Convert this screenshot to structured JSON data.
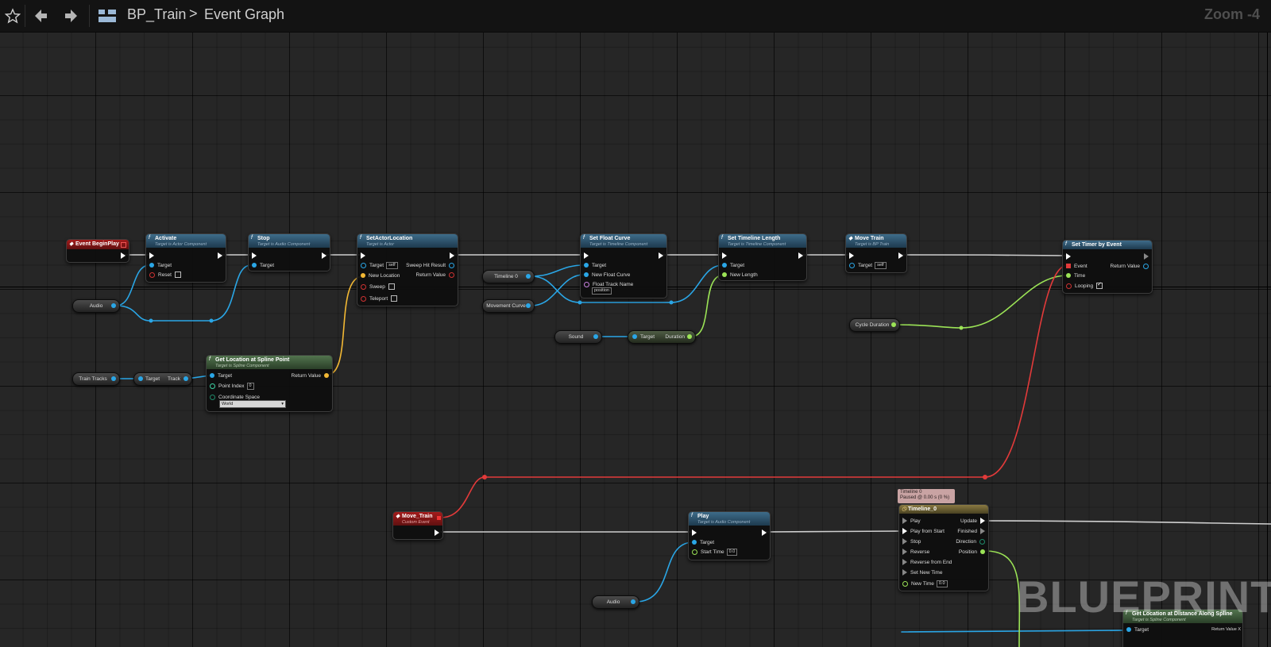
{
  "toolbar": {
    "favorite_icon": "star-icon",
    "back_icon": "arrow-left-icon",
    "forward_icon": "arrow-right-icon",
    "blueprint_icon": "blueprint-graph-icon",
    "breadcrumb_asset": "BP_Train",
    "breadcrumb_separator": ">",
    "breadcrumb_graph": "Event Graph",
    "zoom": "Zoom -4"
  },
  "colors": {
    "exec_wire": "#cfcfcf",
    "object_wire": "#2aa6e6",
    "vector_wire": "#f2b834",
    "float_wire": "#9be356",
    "delegate_wire": "#e23a3a",
    "function_header": "#2c5573",
    "event_header": "#8b1a1a"
  },
  "nodes": {
    "event_begin_play": {
      "title": "Event BeginPlay"
    },
    "activate": {
      "title": "Activate",
      "subtitle": "Target is Actor Component",
      "pin_target": "Target",
      "pin_reset": "Reset"
    },
    "stop": {
      "title": "Stop",
      "subtitle": "Target is Audio Component",
      "pin_target": "Target"
    },
    "set_actor_location": {
      "title": "SetActorLocation",
      "subtitle": "Target is Actor",
      "pin_target": "Target",
      "pin_target_value": "self",
      "pin_new_location": "New Location",
      "pin_sweep": "Sweep",
      "pin_teleport": "Teleport",
      "out_sweep_hit": "Sweep Hit Result",
      "out_return": "Return Value"
    },
    "set_float_curve": {
      "title": "Set Float Curve",
      "subtitle": "Target is Timeline Component",
      "pin_target": "Target",
      "pin_new_float_curve": "New Float Curve",
      "pin_track_name": "Float Track Name",
      "pin_track_value": "position"
    },
    "set_timeline_length": {
      "title": "Set Timeline Length",
      "subtitle": "Target is Timeline Component",
      "pin_target": "Target",
      "pin_new_length": "New Length"
    },
    "move_train": {
      "title": "Move Train",
      "subtitle": "Target is BP Train",
      "pin_target": "Target",
      "pin_target_value": "self"
    },
    "set_timer_by_event": {
      "title": "Set Timer by Event",
      "pin_event": "Event",
      "pin_time": "Time",
      "pin_looping": "Looping",
      "out_return": "Return Value"
    },
    "get_location_spline": {
      "title": "Get Location at Spline Point",
      "subtitle": "Target is Spline Component",
      "pin_target": "Target",
      "pin_point_index": "Point Index",
      "pin_point_index_value": "0",
      "pin_coord_space": "Coordinate Space",
      "pin_coord_value": "World",
      "out_return": "Return Value"
    },
    "move_train_event": {
      "title": "Move_Train",
      "subtitle": "Custom Event"
    },
    "play": {
      "title": "Play",
      "subtitle": "Target is Audio Component",
      "pin_target": "Target",
      "pin_start_time": "Start Time",
      "pin_start_time_value": "0.0"
    },
    "timeline": {
      "title": "Timeline_0",
      "tooltip_line1": "Timeline 0",
      "tooltip_line2": "Paused @ 0.00 s (0 %)",
      "in_play": "Play",
      "in_play_from_start": "Play from Start",
      "in_stop": "Stop",
      "in_reverse": "Reverse",
      "in_reverse_from_end": "Reverse from End",
      "in_set_new_time": "Set New Time",
      "in_new_time": "New Time",
      "in_new_time_value": "0.0",
      "out_update": "Update",
      "out_finished": "Finished",
      "out_direction": "Direction",
      "out_position": "Position"
    },
    "get_location_distance": {
      "title": "Get Location at Distance Along Spline",
      "subtitle": "Target is Spline Component",
      "pin_target": "Target",
      "out_return": "Return Value X"
    }
  },
  "variables": {
    "audio_1": "Audio",
    "train_tracks": "Train Tracks",
    "track_getter_target": "Target",
    "track_getter_out": "Track",
    "timeline_0": "Timeline 0",
    "movement_curve": "Movement Curve",
    "sound": "Sound",
    "duration_getter_target": "Target",
    "duration_getter_out": "Duration",
    "cycle_duration": "Cycle Duration",
    "audio_2": "Audio"
  },
  "watermark": "BLUEPRINT"
}
